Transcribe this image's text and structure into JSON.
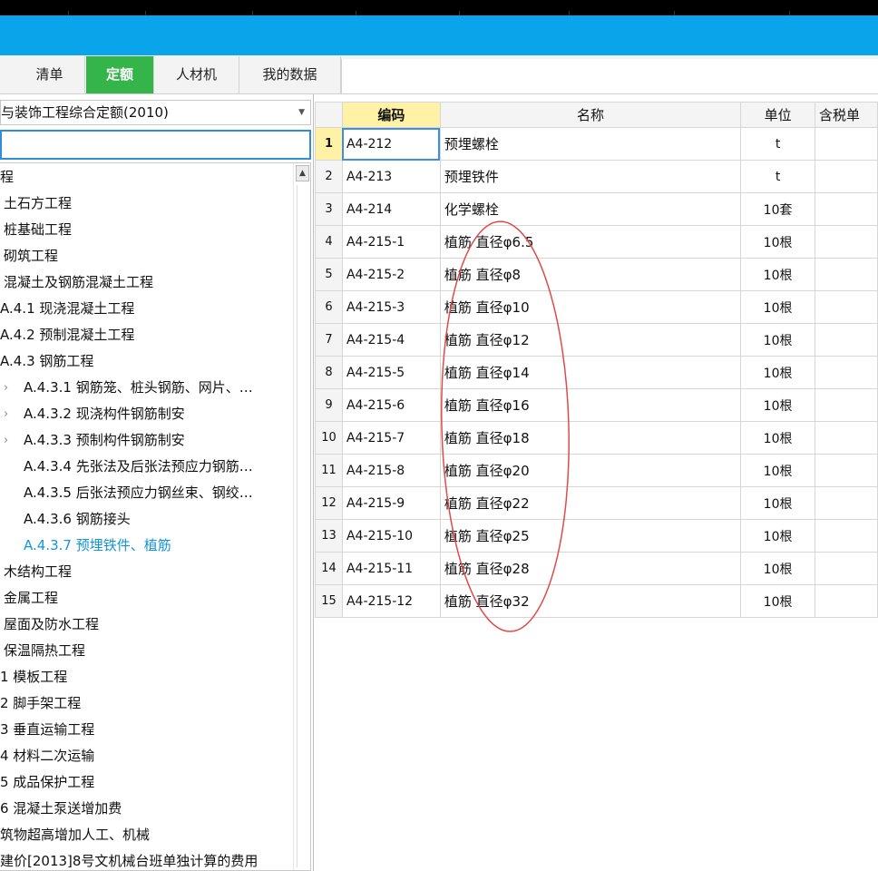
{
  "tabs": [
    {
      "label": "清单",
      "active": false
    },
    {
      "label": "定额",
      "active": true
    },
    {
      "label": "人材机",
      "active": false
    },
    {
      "label": "我的数据",
      "active": false
    }
  ],
  "left": {
    "combo_text": "与装饰工程综合定额(2010)",
    "search_value": "",
    "tree": [
      {
        "label": "程",
        "expander": false,
        "selected": false
      },
      {
        "label": "土石方工程",
        "expander": false,
        "selected": false
      },
      {
        "label": "桩基础工程",
        "expander": false,
        "selected": false
      },
      {
        "label": "砌筑工程",
        "expander": false,
        "selected": false
      },
      {
        "label": "混凝土及钢筋混凝土工程",
        "expander": false,
        "selected": false
      },
      {
        "label": "A.4.1 现浇混凝土工程",
        "expander": false,
        "selected": false
      },
      {
        "label": "A.4.2 预制混凝土工程",
        "expander": false,
        "selected": false
      },
      {
        "label": "A.4.3 钢筋工程",
        "expander": false,
        "selected": false
      },
      {
        "label": "A.4.3.1 钢筋笼、桩头钢筋、网片、…",
        "expander": true,
        "selected": false
      },
      {
        "label": "A.4.3.2 现浇构件钢筋制安",
        "expander": true,
        "selected": false
      },
      {
        "label": "A.4.3.3 预制构件钢筋制安",
        "expander": true,
        "selected": false
      },
      {
        "label": "A.4.3.4 先张法及后张法预应力钢筋…",
        "expander": false,
        "selected": false
      },
      {
        "label": "A.4.3.5 后张法预应力钢丝束、钢绞…",
        "expander": false,
        "selected": false
      },
      {
        "label": "A.4.3.6 钢筋接头",
        "expander": false,
        "selected": false
      },
      {
        "label": "A.4.3.7 预埋铁件、植筋",
        "expander": false,
        "selected": true
      },
      {
        "label": "木结构工程",
        "expander": false,
        "selected": false
      },
      {
        "label": "金属工程",
        "expander": false,
        "selected": false
      },
      {
        "label": "屋面及防水工程",
        "expander": false,
        "selected": false
      },
      {
        "label": "保温隔热工程",
        "expander": false,
        "selected": false
      },
      {
        "label": "1 模板工程",
        "expander": false,
        "selected": false
      },
      {
        "label": "2 脚手架工程",
        "expander": false,
        "selected": false
      },
      {
        "label": "3 垂直运输工程",
        "expander": false,
        "selected": false
      },
      {
        "label": "4 材料二次运输",
        "expander": false,
        "selected": false
      },
      {
        "label": "5 成品保护工程",
        "expander": false,
        "selected": false
      },
      {
        "label": "6 混凝土泵送增加费",
        "expander": false,
        "selected": false
      },
      {
        "label": "筑物超高增加人工、机械",
        "expander": false,
        "selected": false
      },
      {
        "label": "建价[2013]8号文机械台班单独计算的费用",
        "expander": false,
        "selected": false
      }
    ]
  },
  "grid": {
    "headers": {
      "code": "编码",
      "name": "名称",
      "unit": "单位",
      "tax": "含税单"
    },
    "rows": [
      {
        "idx": "1",
        "code": "A4-212",
        "name": "预埋螺栓",
        "unit": "t"
      },
      {
        "idx": "2",
        "code": "A4-213",
        "name": "预埋铁件",
        "unit": "t"
      },
      {
        "idx": "3",
        "code": "A4-214",
        "name": "化学螺栓",
        "unit": "10套"
      },
      {
        "idx": "4",
        "code": "A4-215-1",
        "name": "植筋 直径φ6.5",
        "unit": "10根"
      },
      {
        "idx": "5",
        "code": "A4-215-2",
        "name": "植筋 直径φ8",
        "unit": "10根"
      },
      {
        "idx": "6",
        "code": "A4-215-3",
        "name": "植筋 直径φ10",
        "unit": "10根"
      },
      {
        "idx": "7",
        "code": "A4-215-4",
        "name": "植筋 直径φ12",
        "unit": "10根"
      },
      {
        "idx": "8",
        "code": "A4-215-5",
        "name": "植筋 直径φ14",
        "unit": "10根"
      },
      {
        "idx": "9",
        "code": "A4-215-6",
        "name": "植筋 直径φ16",
        "unit": "10根"
      },
      {
        "idx": "10",
        "code": "A4-215-7",
        "name": "植筋 直径φ18",
        "unit": "10根"
      },
      {
        "idx": "11",
        "code": "A4-215-8",
        "name": "植筋 直径φ20",
        "unit": "10根"
      },
      {
        "idx": "12",
        "code": "A4-215-9",
        "name": "植筋 直径φ22",
        "unit": "10根"
      },
      {
        "idx": "13",
        "code": "A4-215-10",
        "name": "植筋 直径φ25",
        "unit": "10根"
      },
      {
        "idx": "14",
        "code": "A4-215-11",
        "name": "植筋 直径φ28",
        "unit": "10根"
      },
      {
        "idx": "15",
        "code": "A4-215-12",
        "name": "植筋 直径φ32",
        "unit": "10根"
      }
    ],
    "selected_row": 0
  },
  "colors": {
    "accent_blue": "#0aa4ea",
    "active_tab": "#35b44a",
    "selected_tree": "#1296db",
    "header_highlight": "#fff2a6",
    "annotation_ellipse": "#e04a4a"
  },
  "icons": {
    "combo_arrow": "chevron-down-icon",
    "tree_expander": "chevron-right-icon",
    "scroll_up": "arrow-up-icon"
  }
}
